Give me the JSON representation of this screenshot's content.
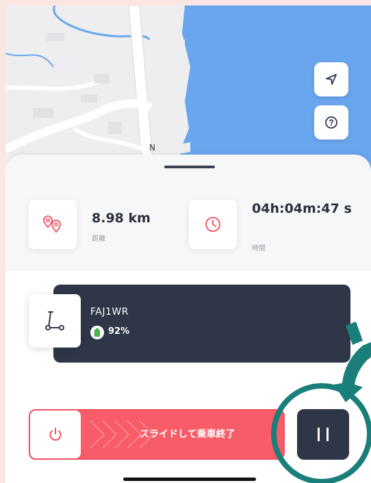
{
  "map": {
    "road_label": "N",
    "locate_icon": "navigation-arrow-icon",
    "help_icon": "question-circle-icon"
  },
  "stats": {
    "distance": {
      "value": "8.98 km",
      "label": "距離",
      "icon": "route-pins-icon"
    },
    "time": {
      "value": "04h:04m:47 s",
      "label": "時間",
      "icon": "clock-icon"
    }
  },
  "vehicle": {
    "id": "FAJ1WR",
    "battery": "92%",
    "icon": "scooter-icon"
  },
  "slider": {
    "label": "スライドして乗車終了",
    "icon": "power-icon"
  },
  "pause": {
    "icon": "pause-icon"
  },
  "colors": {
    "accent_red": "#f85c68",
    "dark_navy": "#2e3648",
    "water_blue": "#6aa6ee",
    "annotation_teal": "#1a7f7a"
  }
}
